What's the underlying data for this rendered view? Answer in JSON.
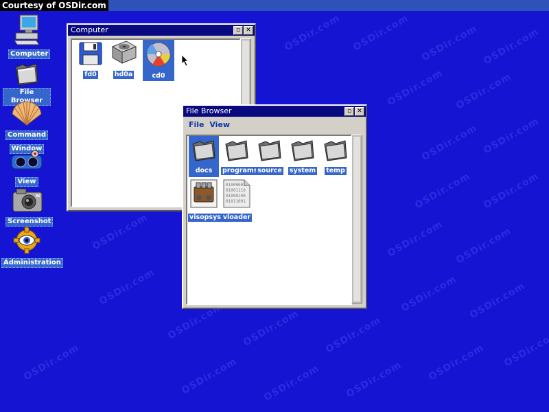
{
  "watermark": {
    "text": "OSDir.com"
  },
  "colors": {
    "desktop": "#1414d2",
    "titlebar": "#0a0a80",
    "label_bg": "#3566cc"
  },
  "desktop": {
    "courtesy": "Courtesy of OSDir.com",
    "icons": [
      {
        "label": "Computer",
        "icon": "computer-icon"
      },
      {
        "label": "File Browser",
        "icon": "folder-icon"
      },
      {
        "label_line1": "Command",
        "label_line2": "Window",
        "icon": "shell-icon"
      },
      {
        "label": "View",
        "icon": "viewmaster-icon"
      },
      {
        "label": "Screenshot",
        "icon": "camera-icon"
      },
      {
        "label": "Administration",
        "icon": "eye-gear-icon"
      }
    ]
  },
  "computer_window": {
    "title": "Computer",
    "restore_glyph": "▫",
    "close_glyph": "✕",
    "items": [
      {
        "label": "fd0",
        "icon": "floppy-disk-icon"
      },
      {
        "label": "hd0a",
        "icon": "hard-disk-icon"
      },
      {
        "label": "cd0",
        "icon": "cd-icon"
      }
    ]
  },
  "file_browser": {
    "title": "File Browser",
    "restore_glyph": "▫",
    "close_glyph": "✕",
    "menu": [
      "File",
      "View"
    ],
    "items": [
      {
        "label": "docs",
        "icon": "folder-icon"
      },
      {
        "label": "programs",
        "icon": "folder-icon"
      },
      {
        "label": "source",
        "icon": "folder-icon"
      },
      {
        "label": "system",
        "icon": "folder-icon"
      },
      {
        "label": "temp",
        "icon": "folder-icon"
      },
      {
        "label": "visopsys",
        "icon": "engine-icon"
      },
      {
        "label": "vloader",
        "icon": "binary-file-icon"
      }
    ],
    "binary_lines": [
      "01000001",
      "01001110",
      "01000100",
      "01011001"
    ]
  }
}
